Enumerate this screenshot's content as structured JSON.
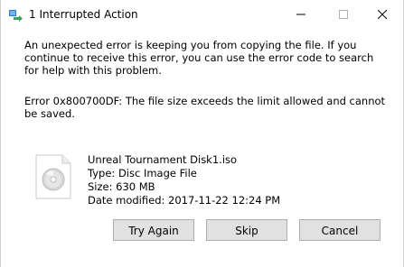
{
  "window": {
    "title": "1 Interrupted Action"
  },
  "message": {
    "body": "An unexpected error is keeping you from copying the file. If you continue to receive this error, you can use the error code to search for help with this problem.",
    "error": "Error 0x800700DF: The file size exceeds the limit allowed and cannot be saved."
  },
  "file": {
    "name": "Unreal Tournament Disk1.iso",
    "type": "Type: Disc Image File",
    "size": "Size: 630 MB",
    "modified": "Date modified: 2017-11-22 12:24 PM",
    "icon": "disc-image-file-icon"
  },
  "buttons": {
    "try_again": "Try Again",
    "skip": "Skip",
    "cancel": "Cancel"
  },
  "colors": {
    "button_face": "#e1e1e1",
    "button_border": "#adadad",
    "app_icon_green": "#3aa35c",
    "app_icon_blue": "#2b7bd6"
  }
}
